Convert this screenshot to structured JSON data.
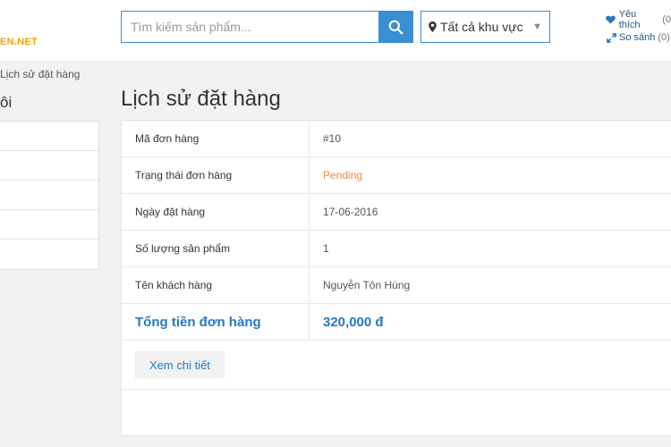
{
  "header": {
    "logo_text": "EN.NET",
    "search": {
      "placeholder": "Tìm kiếm sản phẩm..."
    },
    "region": {
      "selected": "Tất cả khu vực"
    },
    "links": [
      {
        "label": "Yêu thích",
        "count": "(0"
      },
      {
        "label": "So sánh",
        "count": "(0)"
      }
    ]
  },
  "breadcrumb": "Lịch sử đặt hàng",
  "sidebar": {
    "title": "ôi",
    "items": [
      "",
      "",
      "",
      "",
      ""
    ]
  },
  "main": {
    "title": "Lịch sử đặt hàng",
    "rows": [
      {
        "label": "Mã đơn hàng",
        "value": "#10"
      },
      {
        "label": "Trạng thái đơn hàng",
        "value": "Pending"
      },
      {
        "label": "Ngày đặt hàng",
        "value": "17-06-2016"
      },
      {
        "label": "Số lượng sản phẩm",
        "value": "1"
      },
      {
        "label": "Tên khách hàng",
        "value": "Nguyễn Tôn Hùng"
      }
    ],
    "total": {
      "label": "Tổng tiền đơn hàng",
      "value": "320,000 đ"
    },
    "detail_button": "Xem chi tiết"
  },
  "colors": {
    "accent": "#3a8fd2",
    "total": "#2478c4",
    "pending": "#f0883a",
    "logo": "#f0a500"
  },
  "icons": [
    "search-icon",
    "map-pin-icon",
    "chevron-down-icon",
    "heart-icon",
    "compare-icon"
  ]
}
